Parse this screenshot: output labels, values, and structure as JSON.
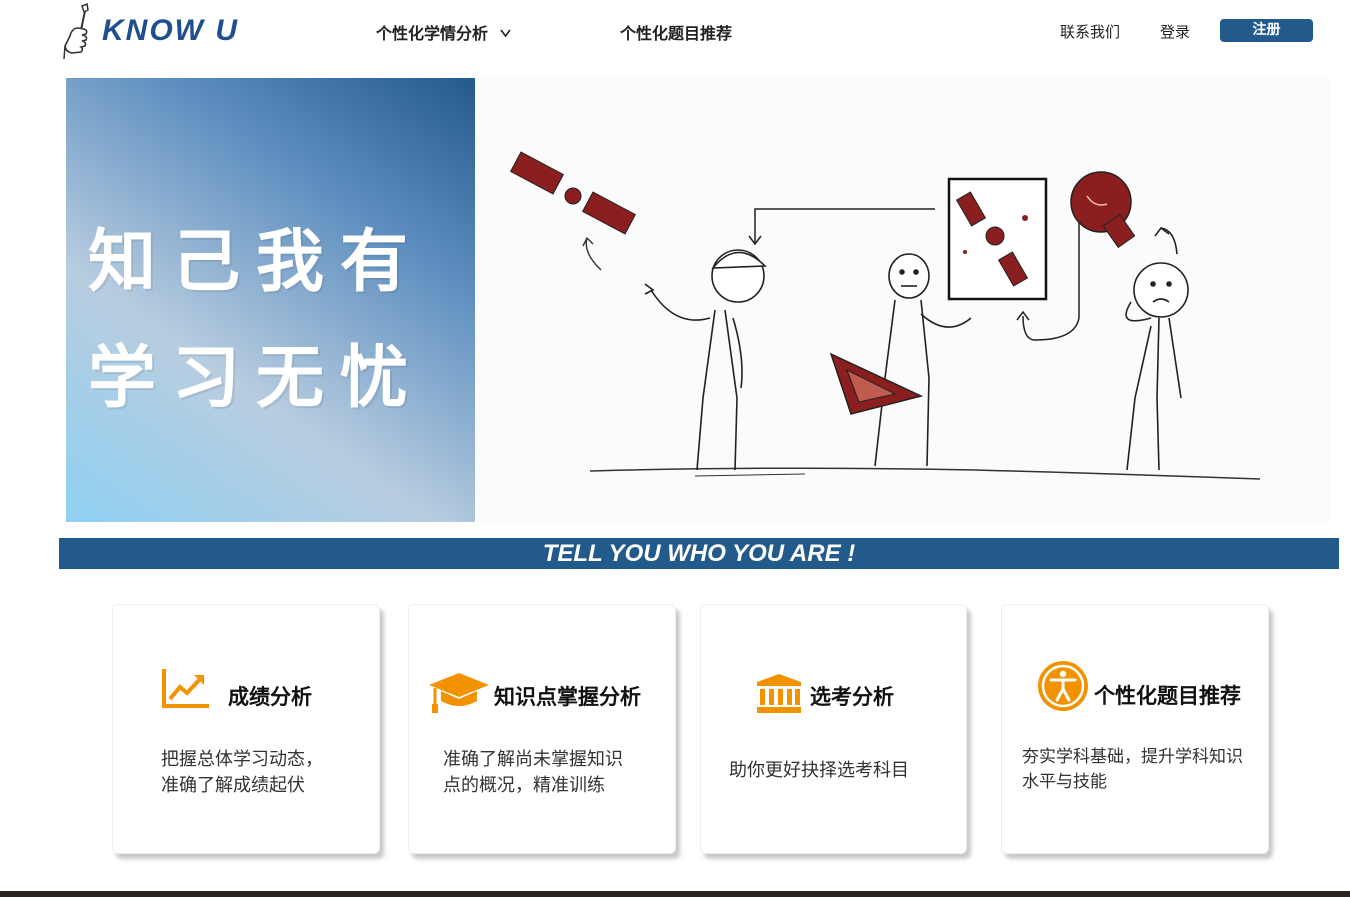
{
  "header": {
    "logo_text": "KNOW U",
    "nav": [
      {
        "label": "个性化学情分析",
        "has_dropdown": true
      },
      {
        "label": "个性化题目推荐",
        "has_dropdown": false
      }
    ],
    "contact_label": "联系我们",
    "login_label": "登录",
    "register_label": "注册"
  },
  "hero": {
    "slogan_line1": "知己我有",
    "slogan_line2": "学习无忧"
  },
  "banner": {
    "text": "TELL YOU WHO YOU ARE !"
  },
  "cards": [
    {
      "title": "成绩分析",
      "icon": "line-chart-icon",
      "desc_line1": "把握总体学习动态，",
      "desc_line2": "准确了解成绩起伏"
    },
    {
      "title": "知识点掌握分析",
      "icon": "graduation-cap-icon",
      "desc_line1": "准确了解尚未掌握知识",
      "desc_line2": "点的概况，精准训练"
    },
    {
      "title": "选考分析",
      "icon": "institution-icon",
      "desc_line1": "助你更好抉择选考科目",
      "desc_line2": ""
    },
    {
      "title": "个性化题目推荐",
      "icon": "accessibility-icon",
      "desc_line1": "夯实学科基础，提升学科知识",
      "desc_line2": "水平与技能"
    }
  ],
  "colors": {
    "brand_blue": "#235a8c",
    "accent_orange": "#f39200",
    "footer": "#2b2624"
  }
}
